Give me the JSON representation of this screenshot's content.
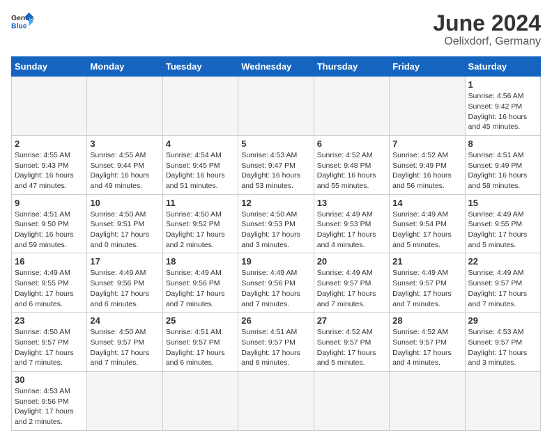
{
  "logo": {
    "text_general": "General",
    "text_blue": "Blue"
  },
  "title": "June 2024",
  "subtitle": "Oelixdorf, Germany",
  "weekdays": [
    "Sunday",
    "Monday",
    "Tuesday",
    "Wednesday",
    "Thursday",
    "Friday",
    "Saturday"
  ],
  "weeks": [
    [
      {
        "day": "",
        "info": ""
      },
      {
        "day": "",
        "info": ""
      },
      {
        "day": "",
        "info": ""
      },
      {
        "day": "",
        "info": ""
      },
      {
        "day": "",
        "info": ""
      },
      {
        "day": "",
        "info": ""
      },
      {
        "day": "1",
        "info": "Sunrise: 4:56 AM\nSunset: 9:42 PM\nDaylight: 16 hours\nand 45 minutes."
      }
    ],
    [
      {
        "day": "2",
        "info": "Sunrise: 4:55 AM\nSunset: 9:43 PM\nDaylight: 16 hours\nand 47 minutes."
      },
      {
        "day": "3",
        "info": "Sunrise: 4:55 AM\nSunset: 9:44 PM\nDaylight: 16 hours\nand 49 minutes."
      },
      {
        "day": "4",
        "info": "Sunrise: 4:54 AM\nSunset: 9:45 PM\nDaylight: 16 hours\nand 51 minutes."
      },
      {
        "day": "5",
        "info": "Sunrise: 4:53 AM\nSunset: 9:47 PM\nDaylight: 16 hours\nand 53 minutes."
      },
      {
        "day": "6",
        "info": "Sunrise: 4:52 AM\nSunset: 9:48 PM\nDaylight: 16 hours\nand 55 minutes."
      },
      {
        "day": "7",
        "info": "Sunrise: 4:52 AM\nSunset: 9:49 PM\nDaylight: 16 hours\nand 56 minutes."
      },
      {
        "day": "8",
        "info": "Sunrise: 4:51 AM\nSunset: 9:49 PM\nDaylight: 16 hours\nand 58 minutes."
      }
    ],
    [
      {
        "day": "9",
        "info": "Sunrise: 4:51 AM\nSunset: 9:50 PM\nDaylight: 16 hours\nand 59 minutes."
      },
      {
        "day": "10",
        "info": "Sunrise: 4:50 AM\nSunset: 9:51 PM\nDaylight: 17 hours\nand 0 minutes."
      },
      {
        "day": "11",
        "info": "Sunrise: 4:50 AM\nSunset: 9:52 PM\nDaylight: 17 hours\nand 2 minutes."
      },
      {
        "day": "12",
        "info": "Sunrise: 4:50 AM\nSunset: 9:53 PM\nDaylight: 17 hours\nand 3 minutes."
      },
      {
        "day": "13",
        "info": "Sunrise: 4:49 AM\nSunset: 9:53 PM\nDaylight: 17 hours\nand 4 minutes."
      },
      {
        "day": "14",
        "info": "Sunrise: 4:49 AM\nSunset: 9:54 PM\nDaylight: 17 hours\nand 5 minutes."
      },
      {
        "day": "15",
        "info": "Sunrise: 4:49 AM\nSunset: 9:55 PM\nDaylight: 17 hours\nand 5 minutes."
      }
    ],
    [
      {
        "day": "16",
        "info": "Sunrise: 4:49 AM\nSunset: 9:55 PM\nDaylight: 17 hours\nand 6 minutes."
      },
      {
        "day": "17",
        "info": "Sunrise: 4:49 AM\nSunset: 9:56 PM\nDaylight: 17 hours\nand 6 minutes."
      },
      {
        "day": "18",
        "info": "Sunrise: 4:49 AM\nSunset: 9:56 PM\nDaylight: 17 hours\nand 7 minutes."
      },
      {
        "day": "19",
        "info": "Sunrise: 4:49 AM\nSunset: 9:56 PM\nDaylight: 17 hours\nand 7 minutes."
      },
      {
        "day": "20",
        "info": "Sunrise: 4:49 AM\nSunset: 9:57 PM\nDaylight: 17 hours\nand 7 minutes."
      },
      {
        "day": "21",
        "info": "Sunrise: 4:49 AM\nSunset: 9:57 PM\nDaylight: 17 hours\nand 7 minutes."
      },
      {
        "day": "22",
        "info": "Sunrise: 4:49 AM\nSunset: 9:57 PM\nDaylight: 17 hours\nand 7 minutes."
      }
    ],
    [
      {
        "day": "23",
        "info": "Sunrise: 4:50 AM\nSunset: 9:57 PM\nDaylight: 17 hours\nand 7 minutes."
      },
      {
        "day": "24",
        "info": "Sunrise: 4:50 AM\nSunset: 9:57 PM\nDaylight: 17 hours\nand 7 minutes."
      },
      {
        "day": "25",
        "info": "Sunrise: 4:51 AM\nSunset: 9:57 PM\nDaylight: 17 hours\nand 6 minutes."
      },
      {
        "day": "26",
        "info": "Sunrise: 4:51 AM\nSunset: 9:57 PM\nDaylight: 17 hours\nand 6 minutes."
      },
      {
        "day": "27",
        "info": "Sunrise: 4:52 AM\nSunset: 9:57 PM\nDaylight: 17 hours\nand 5 minutes."
      },
      {
        "day": "28",
        "info": "Sunrise: 4:52 AM\nSunset: 9:57 PM\nDaylight: 17 hours\nand 4 minutes."
      },
      {
        "day": "29",
        "info": "Sunrise: 4:53 AM\nSunset: 9:57 PM\nDaylight: 17 hours\nand 3 minutes."
      }
    ],
    [
      {
        "day": "30",
        "info": "Sunrise: 4:53 AM\nSunset: 9:56 PM\nDaylight: 17 hours\nand 2 minutes."
      },
      {
        "day": "",
        "info": ""
      },
      {
        "day": "",
        "info": ""
      },
      {
        "day": "",
        "info": ""
      },
      {
        "day": "",
        "info": ""
      },
      {
        "day": "",
        "info": ""
      },
      {
        "day": "",
        "info": ""
      }
    ]
  ]
}
